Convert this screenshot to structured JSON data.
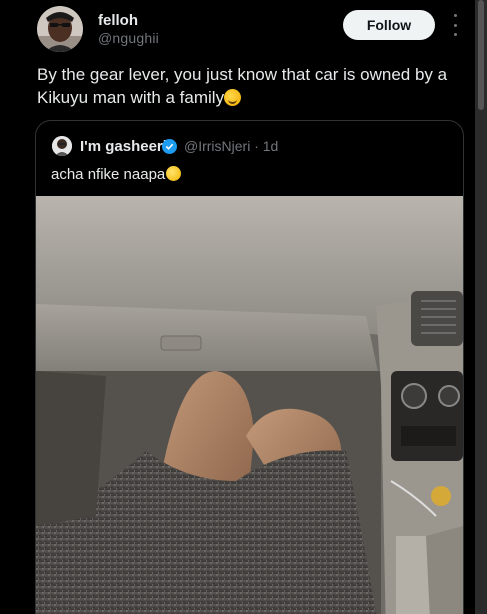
{
  "tweet": {
    "author_name": "felloh",
    "author_handle": "@ngughii",
    "follow_label": "Follow",
    "text": "By the gear lever, you just know that car is owned by a Kikuyu man with a family"
  },
  "quoted_tweet": {
    "author_name": "I'm gasheeri",
    "author_handle": "@IrrisNjeri",
    "time": "· 1d",
    "text": "acha nfike naapa"
  },
  "icons": {
    "more": "more-options-icon",
    "verified": "verified-badge-icon",
    "emoji_main": "grinning-sweat-emoji",
    "emoji_quote": "smiling-emoji"
  },
  "colors": {
    "background": "#000000",
    "text": "#e7e9ea",
    "muted": "#71767b",
    "follow_bg": "#eff3f4",
    "verified": "#1d9bf0"
  }
}
